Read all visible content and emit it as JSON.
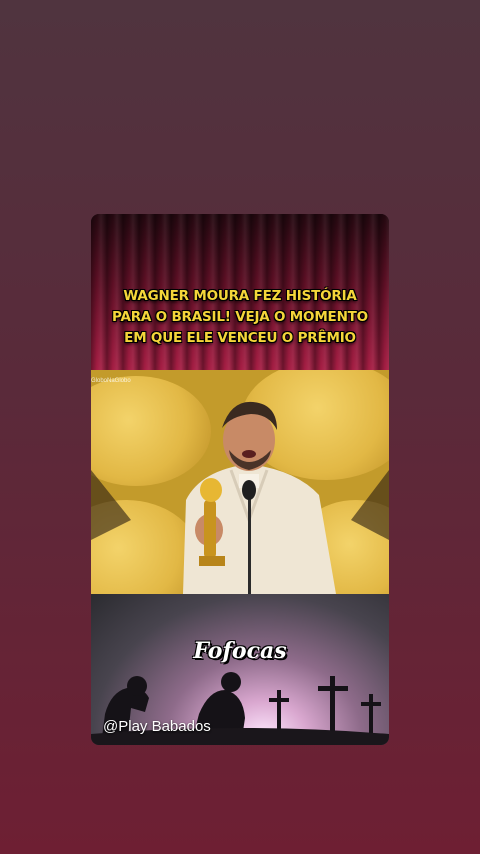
{
  "post": {
    "headline": "WAGNER MOURA FEZ HISTÓRIA\nPARA O BRASIL! VEJA O MOMENTO\nEM QUE ELE VENCEU O PRÊMIO",
    "photo_watermark": "GloboNaGlobo",
    "brand_title": "Fofocas",
    "handle": "@Play Babados"
  },
  "colors": {
    "background_top": "#50343f",
    "background_bottom": "#6e1f33",
    "headline_text": "#f5d63a",
    "curtain_red": "#a61e44",
    "photo_gold": "#e2b845",
    "suit_cream": "#efe6d4"
  },
  "icons": {
    "banner_silhouettes": "mourning-figures-with-crosses-icon"
  }
}
